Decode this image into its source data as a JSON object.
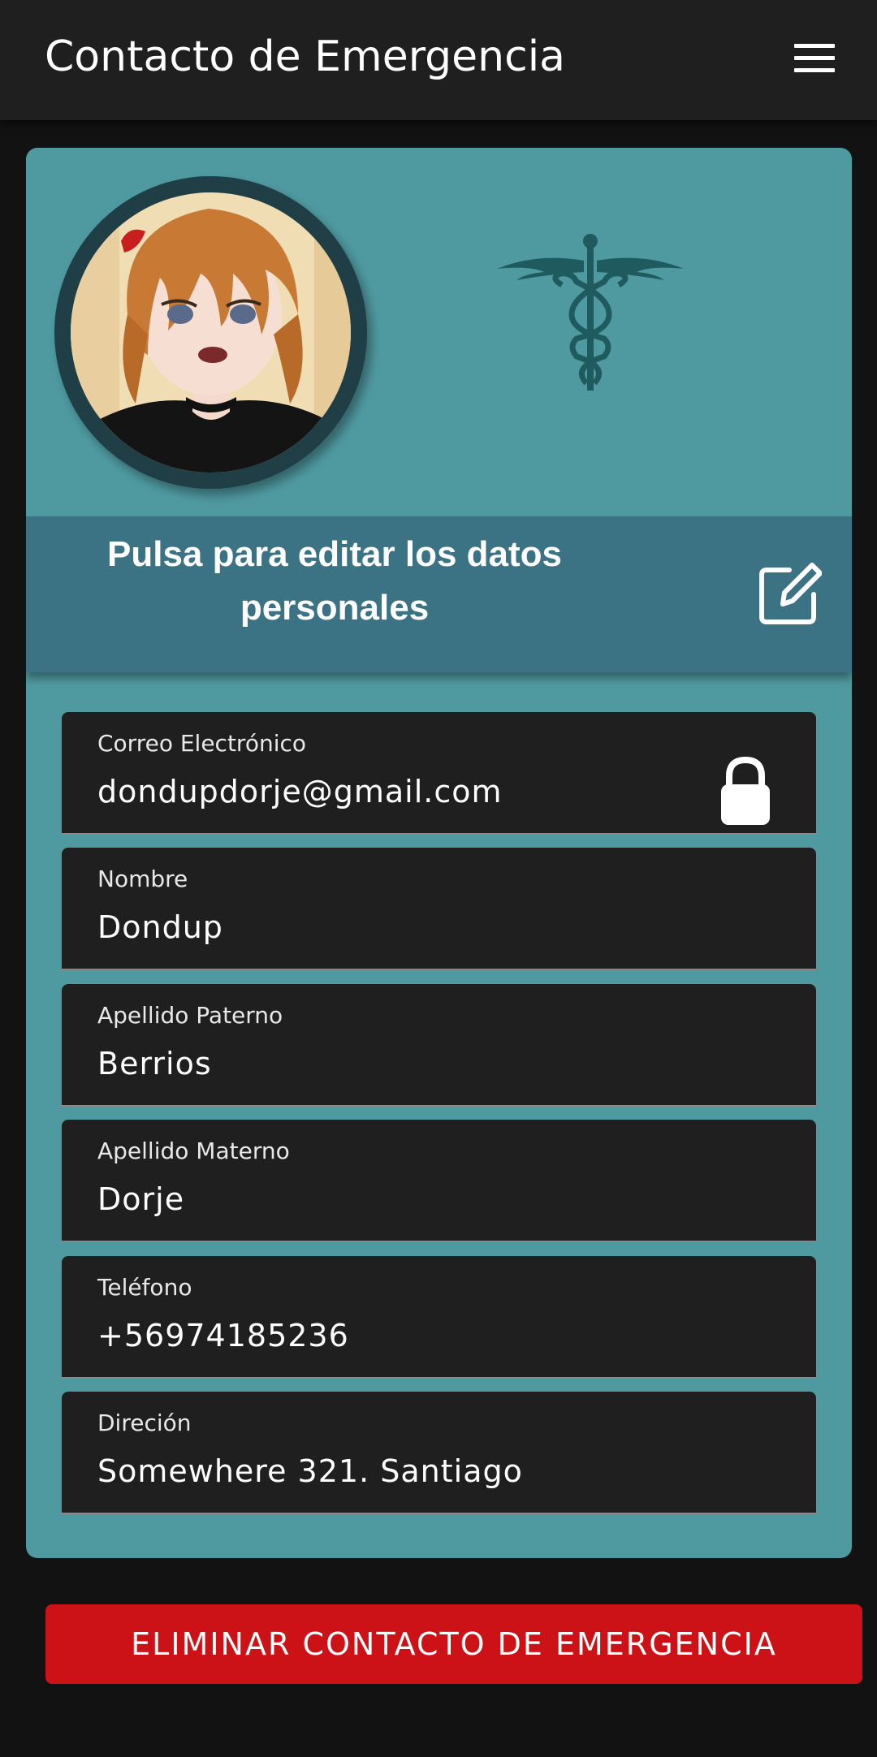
{
  "app_bar": {
    "title": "Contacto de Emergencia",
    "menu_icon": "hamburger-menu-icon"
  },
  "profile": {
    "avatar_alt": "avatar",
    "emblem_icon": "caduceus-icon",
    "edit_prompt": "Pulsa para editar los datos personales",
    "edit_icon": "edit-icon"
  },
  "fields": [
    {
      "label": "Correo Electrónico",
      "value": "dondupdorje@gmail.com",
      "locked": true
    },
    {
      "label": "Nombre",
      "value": "Dondup"
    },
    {
      "label": "Apellido Paterno",
      "value": "Berrios"
    },
    {
      "label": "Apellido Materno",
      "value": "Dorje"
    },
    {
      "label": "Teléfono",
      "value": "+56974185236"
    },
    {
      "label": "Direción",
      "value": "Somewhere 321. Santiago"
    }
  ],
  "actions": {
    "delete_label": "ELIMINAR CONTACTO DE EMERGENCIA"
  },
  "colors": {
    "app_bar": "#1f1f1f",
    "card": "#4f9aa1",
    "edit_band": "#3b7385",
    "field_bg": "#1f1f1f",
    "delete_button": "#cc1216"
  }
}
